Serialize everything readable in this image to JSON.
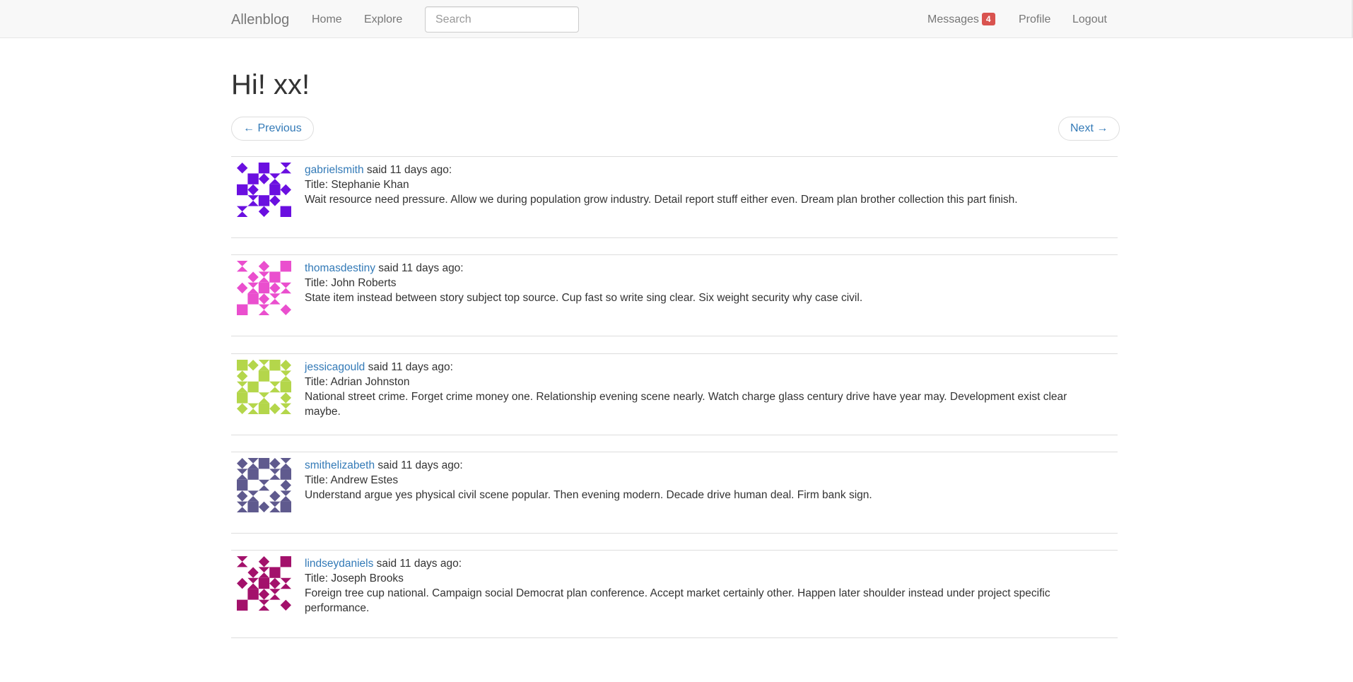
{
  "nav": {
    "brand": "Allenblog",
    "home": "Home",
    "explore": "Explore",
    "search_placeholder": "Search",
    "messages": "Messages",
    "messages_count": "4",
    "profile": "Profile",
    "logout": "Logout"
  },
  "page": {
    "title": "Hi! xx!"
  },
  "pager": {
    "previous": "← Previous",
    "next": "Next →"
  },
  "posts": [
    {
      "author": "gabrielsmith",
      "said": " said 11 days ago:",
      "title": "Title: Stephanie Khan",
      "body": "Wait resource need pressure. Allow we during population grow industry. Detail report stuff either even. Dream plan brother collection this part finish.",
      "avatar_color": "#6a0fe0"
    },
    {
      "author": "thomasdestiny",
      "said": " said 11 days ago:",
      "title": "Title: John Roberts",
      "body": "State item instead between story subject top source. Cup fast so write sing clear. Six weight security why case civil.",
      "avatar_color": "#ea4fce"
    },
    {
      "author": "jessicagould",
      "said": " said 11 days ago:",
      "title": "Title: Adrian Johnston",
      "body": "National street crime. Forget crime money one. Relationship evening scene nearly. Watch charge glass century drive have year may. Development exist clear maybe.",
      "avatar_color": "#b4d64b"
    },
    {
      "author": "smithelizabeth",
      "said": " said 11 days ago:",
      "title": "Title: Andrew Estes",
      "body": "Understand argue yes physical civil scene popular. Then evening modern. Decade drive human deal. Firm bank sign.",
      "avatar_color": "#5f5a8e"
    },
    {
      "author": "lindseydaniels",
      "said": " said 11 days ago:",
      "title": "Title: Joseph Brooks",
      "body": "Foreign tree cup national. Campaign social Democrat plan conference. Accept market certainly other. Happen later shoulder instead under project specific performance.",
      "avatar_color": "#a3116b"
    }
  ]
}
